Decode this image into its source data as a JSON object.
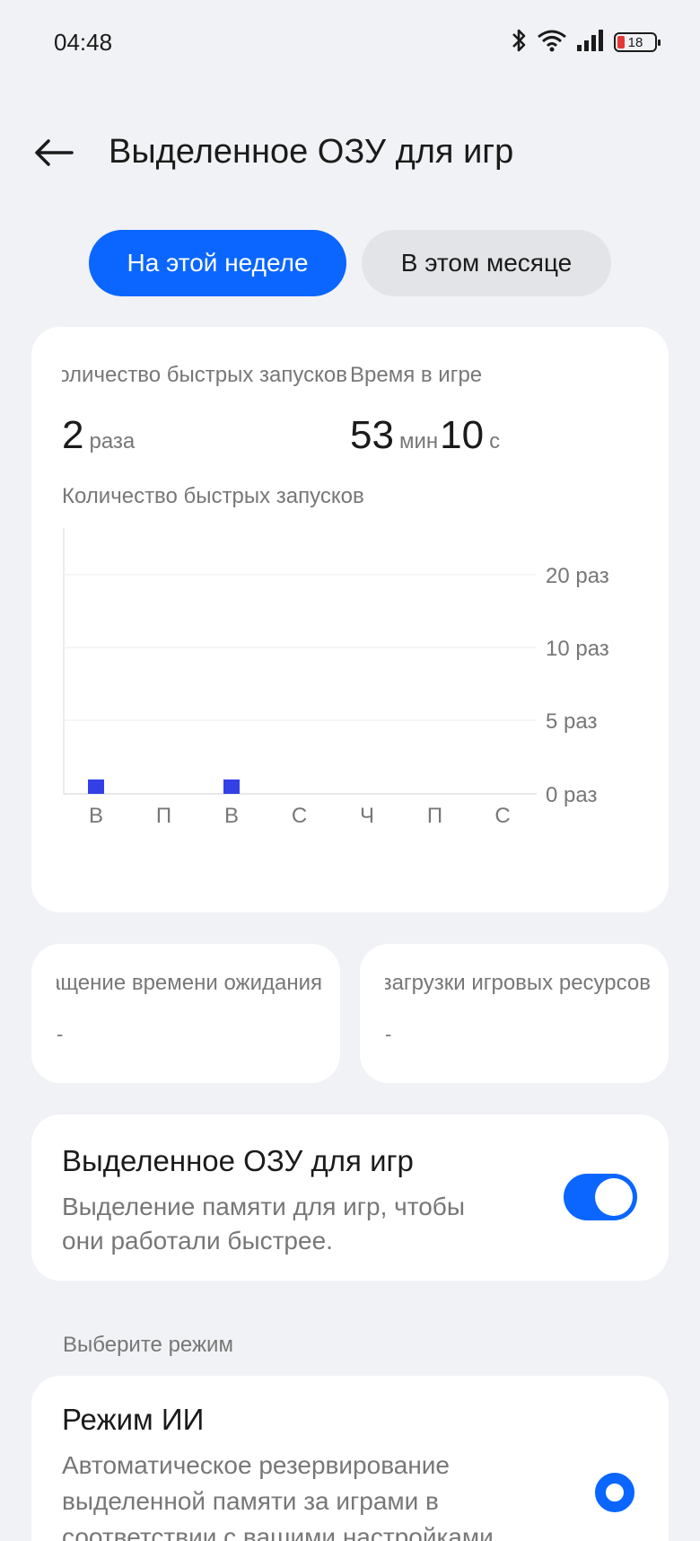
{
  "status_bar": {
    "time": "04:48",
    "battery_level": "18"
  },
  "header": {
    "title": "Выделенное ОЗУ для игр",
    "back_icon": "arrow-left-icon"
  },
  "tabs": [
    {
      "label": "На этой неделе",
      "active": true
    },
    {
      "label": "В этом месяце",
      "active": false
    }
  ],
  "stats": {
    "launches_label": "Количество быстрых запусков",
    "launches_value": "2",
    "launches_unit": "раза",
    "playtime_label": "Время в игре",
    "playtime_min_value": "53",
    "playtime_min_unit": "мин",
    "playtime_sec_value": "10",
    "playtime_sec_unit": "с"
  },
  "chart_data": {
    "type": "bar",
    "title": "Количество быстрых запусков",
    "categories": [
      "В",
      "П",
      "В",
      "С",
      "Ч",
      "П",
      "С"
    ],
    "values": [
      1,
      0,
      1,
      0,
      0,
      0,
      0
    ],
    "y_ticks": [
      0,
      5,
      10,
      20
    ],
    "y_tick_labels": [
      "0 раз",
      "5 раз",
      "10 раз",
      "20 раз"
    ],
    "bar_color": "#3340e6",
    "grid": true
  },
  "small_cards": [
    {
      "title": "Сокращение времени ожидания",
      "value": "-"
    },
    {
      "title": "Ускорение загрузки игровых ресурсов",
      "value": "-"
    }
  ],
  "toggle": {
    "title": "Выделенное ОЗУ для игр",
    "description": "Выделение памяти для игр, чтобы они работали быстрее.",
    "on": true
  },
  "mode_section": {
    "label": "Выберите режим",
    "mode_title": "Режим ИИ",
    "mode_description": "Автоматическое резервирование выделенной памяти за играми в соответствии с вашими настройками"
  },
  "colors": {
    "accent": "#0a66ff",
    "background": "#f1f2f5"
  }
}
